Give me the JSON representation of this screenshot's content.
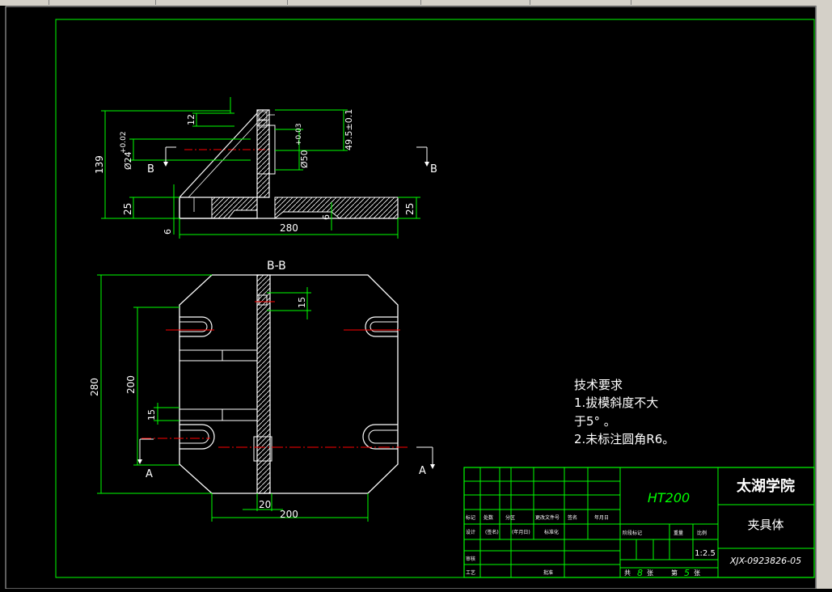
{
  "drawing": {
    "dims": {
      "d12": "12",
      "d139": "139",
      "d25_left": "25",
      "d24": "Ø24",
      "d24_tol": "+0.02",
      "d50": "Ø50",
      "d50_tol": "+0.03",
      "d49": "49.5±0.1",
      "d6_left": "6",
      "d280_h": "280",
      "d25_right": "25",
      "d6_right": "6",
      "d280_v": "280",
      "d200_v": "200",
      "d15_top": "15",
      "d15_bottom": "15",
      "d20": "20",
      "d200_h": "200"
    },
    "section_labels": {
      "b_left": "B",
      "b_right": "B",
      "section_title": "B-B",
      "a_left": "A",
      "a_right": "A"
    },
    "notes": {
      "title": "技术要求",
      "line1": "1.拔模斜度不大",
      "line2": "于5° 。",
      "line3": "2.未标注圆角R6。"
    }
  },
  "title_block": {
    "material": "HT200",
    "school": "太湖学院",
    "part_name": "夹具体",
    "drawing_no": "XJX-0923826-05",
    "scale": "1:2.5",
    "sheets_total_label": "共",
    "sheets_total": "8",
    "sheet_label": "张",
    "sheet_no_label": "第",
    "sheet_no": "5",
    "sheet_no_suffix": "张",
    "header_cells": [
      "标记",
      "处数",
      "分区",
      "更改文件号",
      "签名",
      "年月日"
    ],
    "row_design": [
      "设计",
      "(签名)",
      "(年月日)",
      "标准化"
    ],
    "row_review": "审核",
    "row_process": "工艺",
    "row_approve": "批准",
    "stage_headers": [
      "阶段标记",
      "重量",
      "比例"
    ]
  }
}
